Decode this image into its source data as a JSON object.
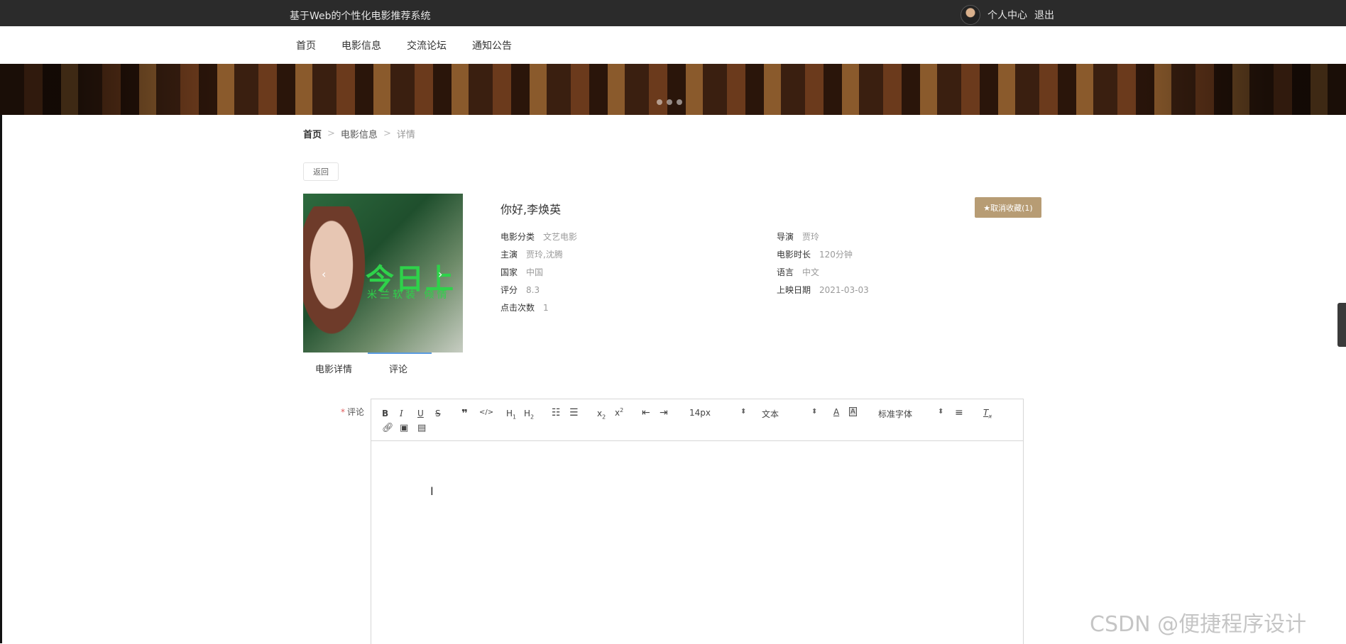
{
  "header": {
    "site_title": "基于Web的个性化电影推荐系统",
    "user_center": "个人中心",
    "logout": "退出"
  },
  "nav": {
    "items": [
      "首页",
      "电影信息",
      "交流论坛",
      "通知公告"
    ]
  },
  "breadcrumb": {
    "home": "首页",
    "section": "电影信息",
    "current": "详情",
    "separator": ">"
  },
  "back_button": "返回",
  "poster": {
    "headline": "今日上",
    "subline": "米兰软装 倾情"
  },
  "movie": {
    "title": "你好,李焕英",
    "favorite_button": "★取消收藏(1)",
    "fields": [
      {
        "label": "电影分类",
        "value": "文艺电影"
      },
      {
        "label": "导演",
        "value": "贾玲"
      },
      {
        "label": "主演",
        "value": "贾玲,沈腾"
      },
      {
        "label": "电影时长",
        "value": "120分钟"
      },
      {
        "label": "国家",
        "value": "中国"
      },
      {
        "label": "语言",
        "value": "中文"
      },
      {
        "label": "评分",
        "value": "8.3"
      },
      {
        "label": "上映日期",
        "value": "2021-03-03"
      },
      {
        "label": "点击次数",
        "value": "1"
      }
    ]
  },
  "tabs": [
    "电影详情",
    "评论"
  ],
  "comment": {
    "label": "评论",
    "required_mark": "*"
  },
  "editor": {
    "font_size": "14px",
    "paragraph": "文本",
    "font_family": "标准字体"
  },
  "watermark": "CSDN @便捷程序设计"
}
